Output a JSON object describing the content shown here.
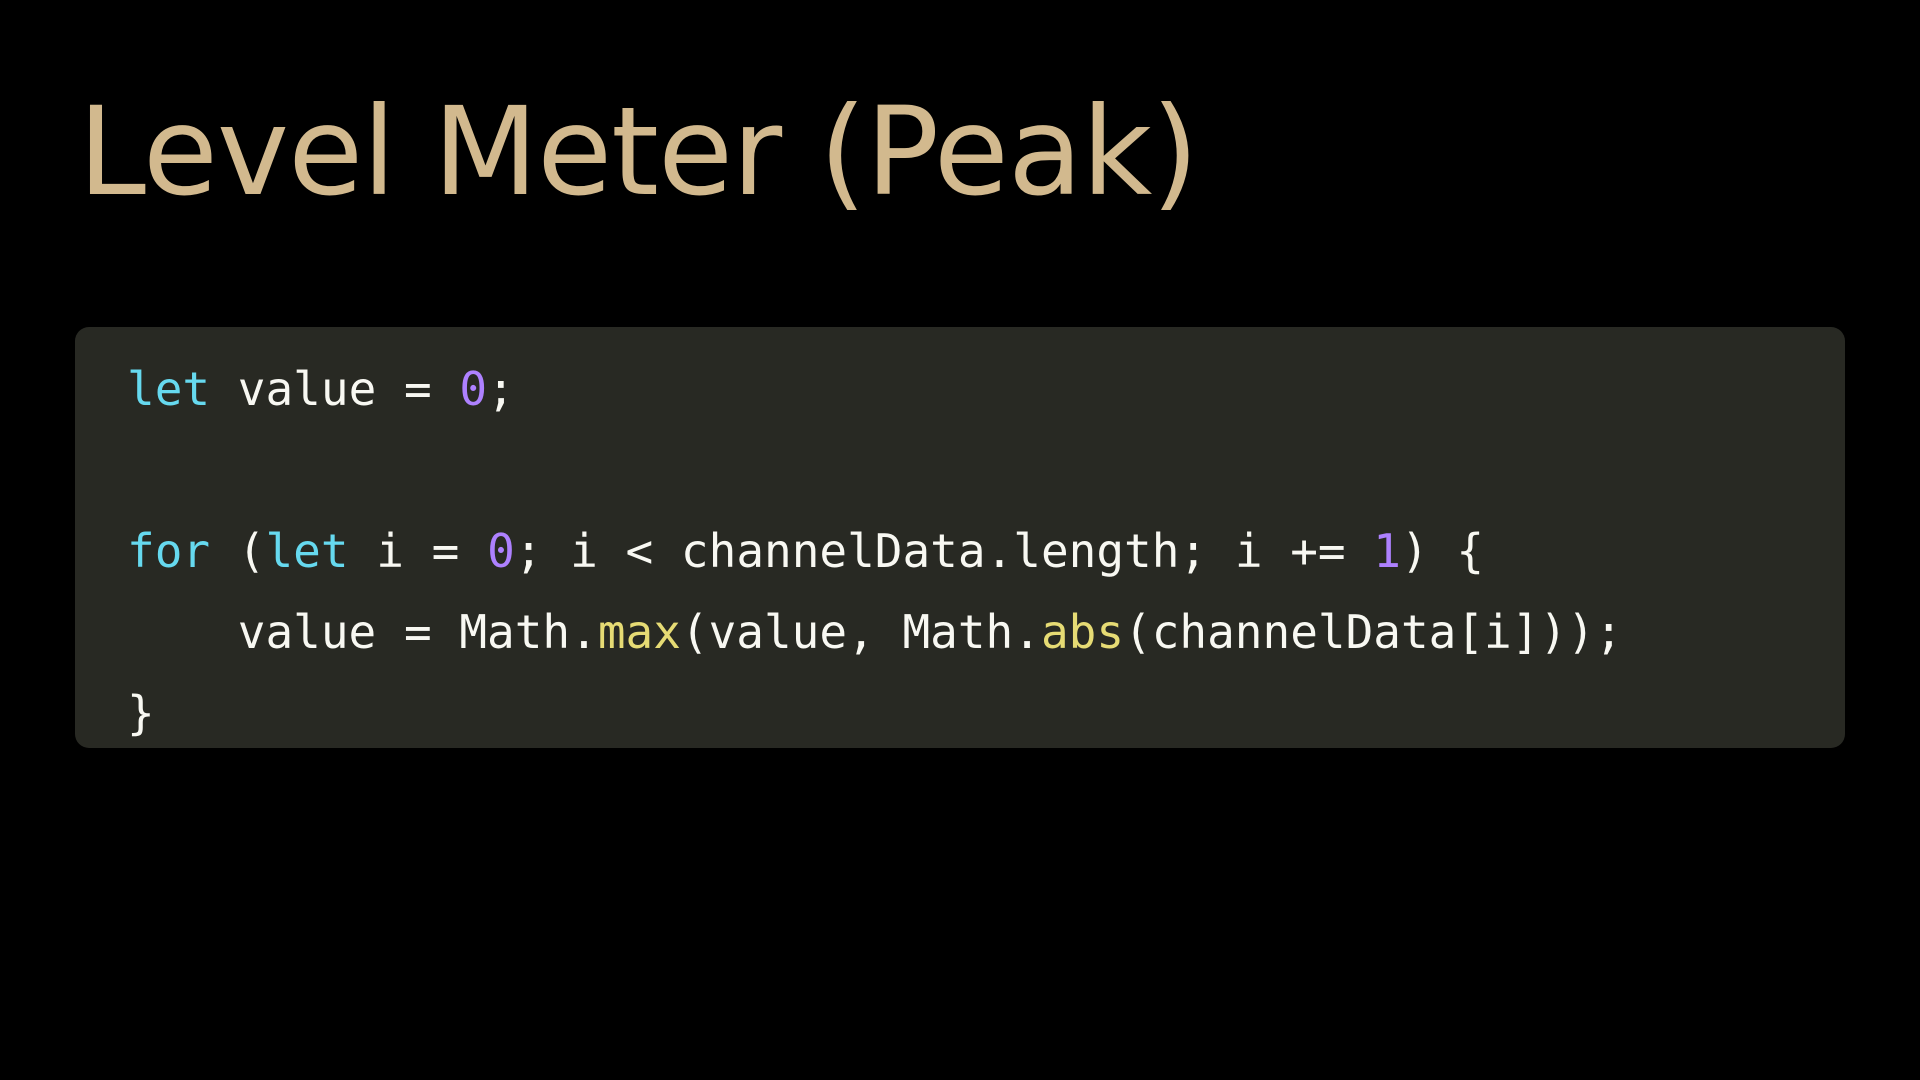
{
  "slide": {
    "title": "Level Meter (Peak)"
  },
  "colors": {
    "background": "#000000",
    "title": "#d2b98e",
    "code_background": "#282923",
    "code_text": "#f8f8f2",
    "keyword": "#66d9ef",
    "number": "#ae81ff",
    "function": "#e6db74"
  },
  "code": {
    "language": "javascript",
    "lines": [
      {
        "tokens": [
          {
            "t": "let",
            "c": "kw"
          },
          {
            "t": " value = ",
            "c": "plain"
          },
          {
            "t": "0",
            "c": "num"
          },
          {
            "t": ";",
            "c": "plain"
          }
        ]
      },
      {
        "tokens": []
      },
      {
        "tokens": [
          {
            "t": "for",
            "c": "kw"
          },
          {
            "t": " (",
            "c": "plain"
          },
          {
            "t": "let",
            "c": "kw"
          },
          {
            "t": " i = ",
            "c": "plain"
          },
          {
            "t": "0",
            "c": "num"
          },
          {
            "t": "; i < channelData.length; i += ",
            "c": "plain"
          },
          {
            "t": "1",
            "c": "num"
          },
          {
            "t": ") {",
            "c": "plain"
          }
        ]
      },
      {
        "tokens": [
          {
            "t": "    value = Math.",
            "c": "plain"
          },
          {
            "t": "max",
            "c": "fn"
          },
          {
            "t": "(value, Math.",
            "c": "plain"
          },
          {
            "t": "abs",
            "c": "fn"
          },
          {
            "t": "(channelData[i]));",
            "c": "plain"
          }
        ]
      },
      {
        "tokens": [
          {
            "t": "}",
            "c": "plain"
          }
        ]
      }
    ]
  }
}
